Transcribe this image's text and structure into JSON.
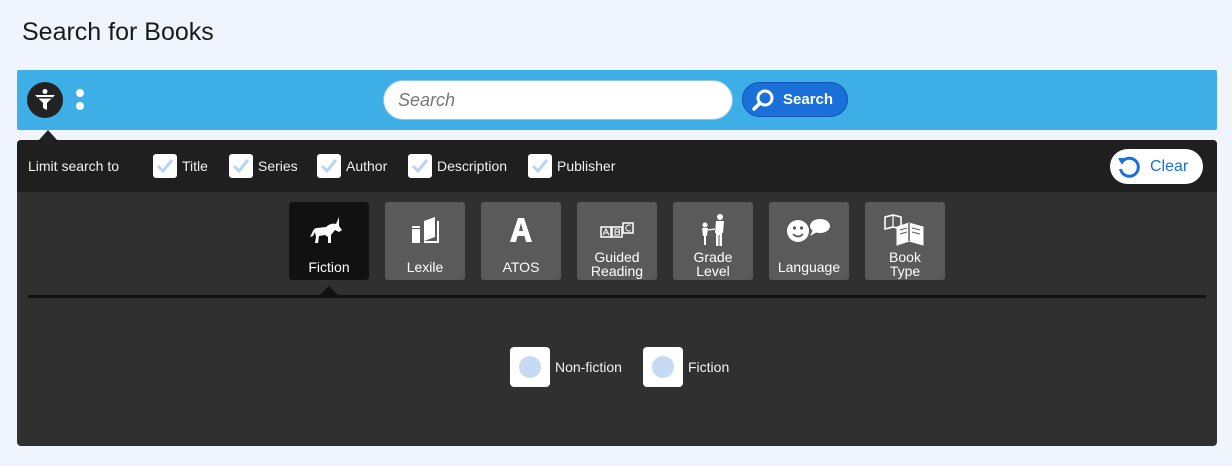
{
  "page": {
    "title": "Search for Books"
  },
  "search": {
    "placeholder": "Search",
    "value": "",
    "button_label": "Search"
  },
  "limit": {
    "label": "Limit search to",
    "options": [
      {
        "label": "Title",
        "checked": true
      },
      {
        "label": "Series",
        "checked": true
      },
      {
        "label": "Author",
        "checked": true
      },
      {
        "label": "Description",
        "checked": true
      },
      {
        "label": "Publisher",
        "checked": true
      }
    ],
    "clear_label": "Clear"
  },
  "tabs": [
    {
      "label": "Fiction",
      "icon": "unicorn-icon",
      "active": true
    },
    {
      "label": "Lexile",
      "icon": "books-icon",
      "active": false
    },
    {
      "label": "ATOS",
      "icon": "letter-a-icon",
      "active": false
    },
    {
      "label_line1": "Guided",
      "label_line2": "Reading",
      "icon": "abc-blocks-icon",
      "active": false
    },
    {
      "label_line1": "Grade",
      "label_line2": "Level",
      "icon": "child-adult-icon",
      "active": false
    },
    {
      "label": "Language",
      "icon": "speech-face-icon",
      "active": false
    },
    {
      "label_line1": "Book",
      "label_line2": "Type",
      "icon": "open-books-icon",
      "active": false
    }
  ],
  "fiction_filter": {
    "options": [
      {
        "label": "Non-fiction",
        "selected": false
      },
      {
        "label": "Fiction",
        "selected": false
      }
    ]
  },
  "colors": {
    "bar": "#3daee6",
    "panel": "#303030",
    "accent": "#1a6fd8"
  }
}
